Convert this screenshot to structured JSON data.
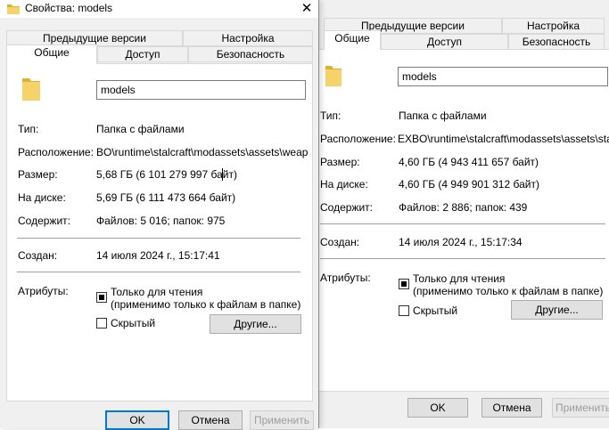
{
  "front": {
    "title": "Свойства: models",
    "tabs_row1": [
      "Предыдущие версии",
      "Настройка"
    ],
    "tabs_row2": [
      "Общие",
      "Доступ",
      "Безопасность"
    ],
    "name": "models",
    "type_label": "Тип:",
    "type_value": "Папка с файлами",
    "location_label": "Расположение:",
    "location_value": "BO\\runtime\\stalcraft\\modassets\\assets\\weapons",
    "size_label": "Размер:",
    "size_value": "5,68 ГБ (6 101 279 997 байт)",
    "disk_label": "На диске:",
    "disk_value": "5,69 ГБ (6 111 473 664 байт)",
    "contains_label": "Содержит:",
    "contains_value": "Файлов: 5 016; папок: 975",
    "created_label": "Создан:",
    "created_value": "14 июля 2024 г., 15:17:41",
    "attributes_label": "Атрибуты:",
    "readonly_label": "Только для чтения",
    "readonly_note": "(применимо только к файлам в папке)",
    "hidden_label": "Скрытый",
    "other_button": "Другие...",
    "ok": "OK",
    "cancel": "Отмена",
    "apply": "Применить"
  },
  "back": {
    "tabs_row1": [
      "Предыдущие версии",
      "Настройка"
    ],
    "tabs_row2": [
      "Общие",
      "Доступ",
      "Безопасность"
    ],
    "name": "models",
    "type_label": "Тип:",
    "type_value": "Папка с файлами",
    "location_label": "Расположение:",
    "location_value": "EXBO\\runtime\\stalcraft\\modassets\\assets\\stalker",
    "size_label": "Размер:",
    "size_value": "4,60 ГБ (4 943 411 657 байт)",
    "disk_label": "На диске:",
    "disk_value": "4,60 ГБ (4 949 901 312 байт)",
    "contains_label": "Содержит:",
    "contains_value": "Файлов: 2 886; папок: 439",
    "created_label": "Создан:",
    "created_value": "14 июля 2024 г., 15:17:34",
    "attributes_label": "Атрибуты:",
    "readonly_label": "Только для чтения",
    "readonly_note": "(применимо только к файлам в папке)",
    "hidden_label": "Скрытый",
    "other_button": "Другие...",
    "ok": "OK",
    "cancel": "Отмена",
    "apply": "Применить"
  },
  "icons": {
    "folder_color": "#f6d26a",
    "folder_dark": "#e0b030",
    "accent": "#0078d7"
  }
}
